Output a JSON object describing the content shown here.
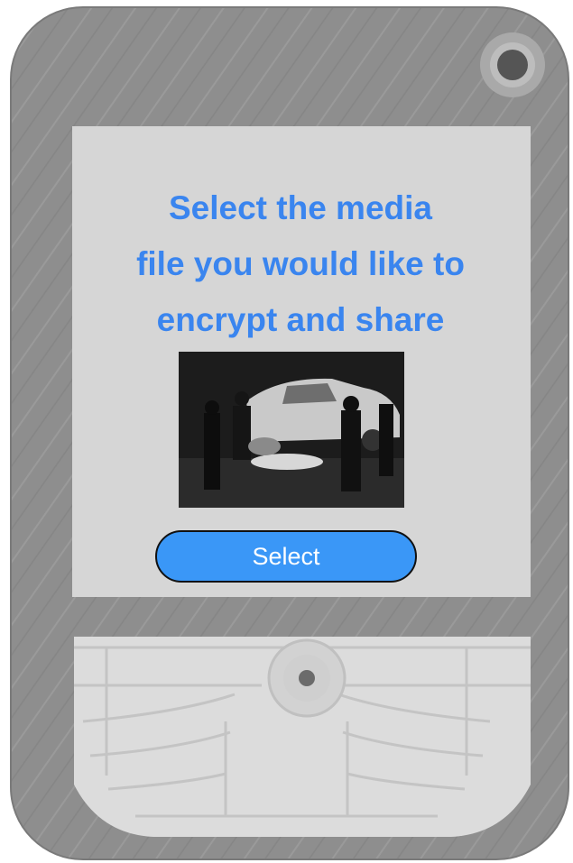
{
  "screen": {
    "prompt_lines": [
      "Select the media",
      "file you would like to",
      "encrypt and share"
    ],
    "select_button_label": "Select"
  },
  "colors": {
    "phone_body": "#8e8e8e",
    "screen_background": "#d6d6d6",
    "prompt_text": "#3a85ef",
    "button_fill": "#3a97f7",
    "button_text": "#ffffff"
  },
  "icons": {
    "camera": "camera-lens-icon",
    "navigation": "nav-center-button-icon"
  }
}
